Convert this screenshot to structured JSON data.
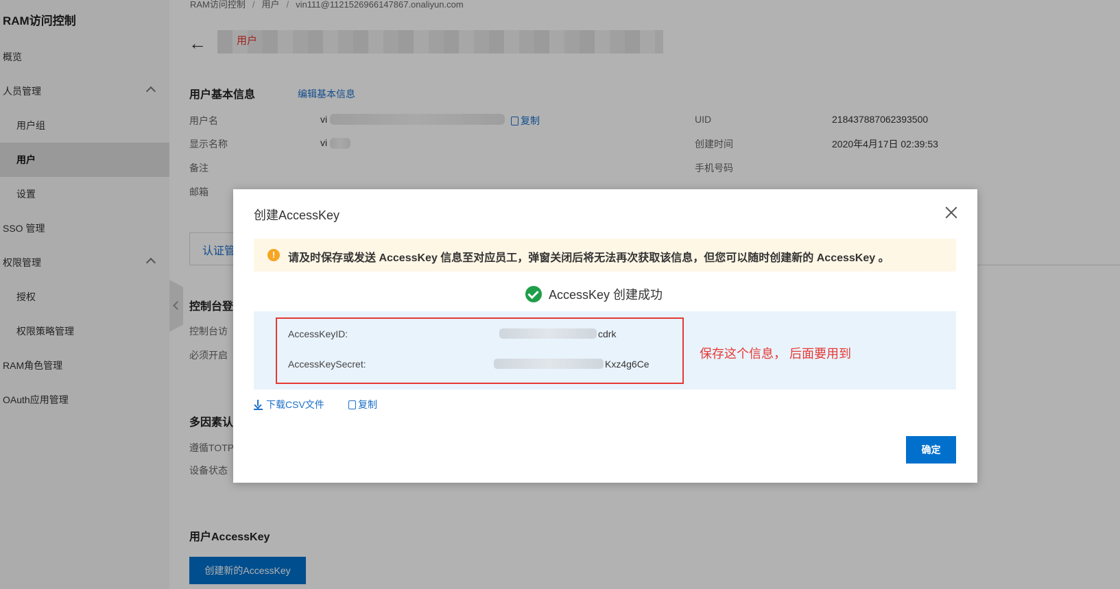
{
  "sidebar": {
    "brand": "RAM访问控制",
    "items": [
      {
        "label": "概览"
      },
      {
        "label": "人员管理"
      },
      {
        "label": "用户组"
      },
      {
        "label": "用户"
      },
      {
        "label": "设置"
      },
      {
        "label": "SSO 管理"
      },
      {
        "label": "权限管理"
      },
      {
        "label": "授权"
      },
      {
        "label": "权限策略管理"
      },
      {
        "label": "RAM角色管理"
      },
      {
        "label": "OAuth应用管理"
      }
    ]
  },
  "breadcrumb": {
    "items": [
      "RAM访问控制",
      "用户",
      "vin111@1121526966147867.onaliyun.com"
    ]
  },
  "header": {
    "user_tag": "用户"
  },
  "basic_info": {
    "title": "用户基本信息",
    "edit_link": "编辑基本信息",
    "username_label": "用户名",
    "username_value": "vi",
    "copy_label": "复制",
    "display_name_label": "显示名称",
    "display_name_value": "vi",
    "remark_label": "备注",
    "email_label": "邮箱",
    "uid_label": "UID",
    "uid_value": "218437887062393500",
    "created_label": "创建时间",
    "created_value": "2020年4月17日 02:39:53",
    "phone_label": "手机号码"
  },
  "tabs": {
    "first": "认证管"
  },
  "console_login": {
    "title": "控制台登",
    "line1": "控制台访",
    "line2": "必须开启"
  },
  "mfa": {
    "title": "多因素认",
    "line1": "遵循TOTP",
    "line2": "设备状态"
  },
  "access_key_section": {
    "title": "用户AccessKey",
    "create_button": "创建新的AccessKey"
  },
  "modal": {
    "title": "创建AccessKey",
    "warning": "请及时保存或发送 AccessKey 信息至对应员工，弹窗关闭后将无法再次获取该信息，但您可以随时创建新的 AccessKey 。",
    "success": "AccessKey 创建成功",
    "key_id_label": "AccessKeyID:",
    "key_id_value_suffix": "cdrk",
    "key_secret_label": "AccessKeySecret:",
    "key_secret_value_suffix": "Kxz4g6Ce",
    "annotation": "保存这个信息， 后面要用到",
    "download_link": "下载CSV文件",
    "copy_link": "复制",
    "confirm_button": "确定"
  }
}
